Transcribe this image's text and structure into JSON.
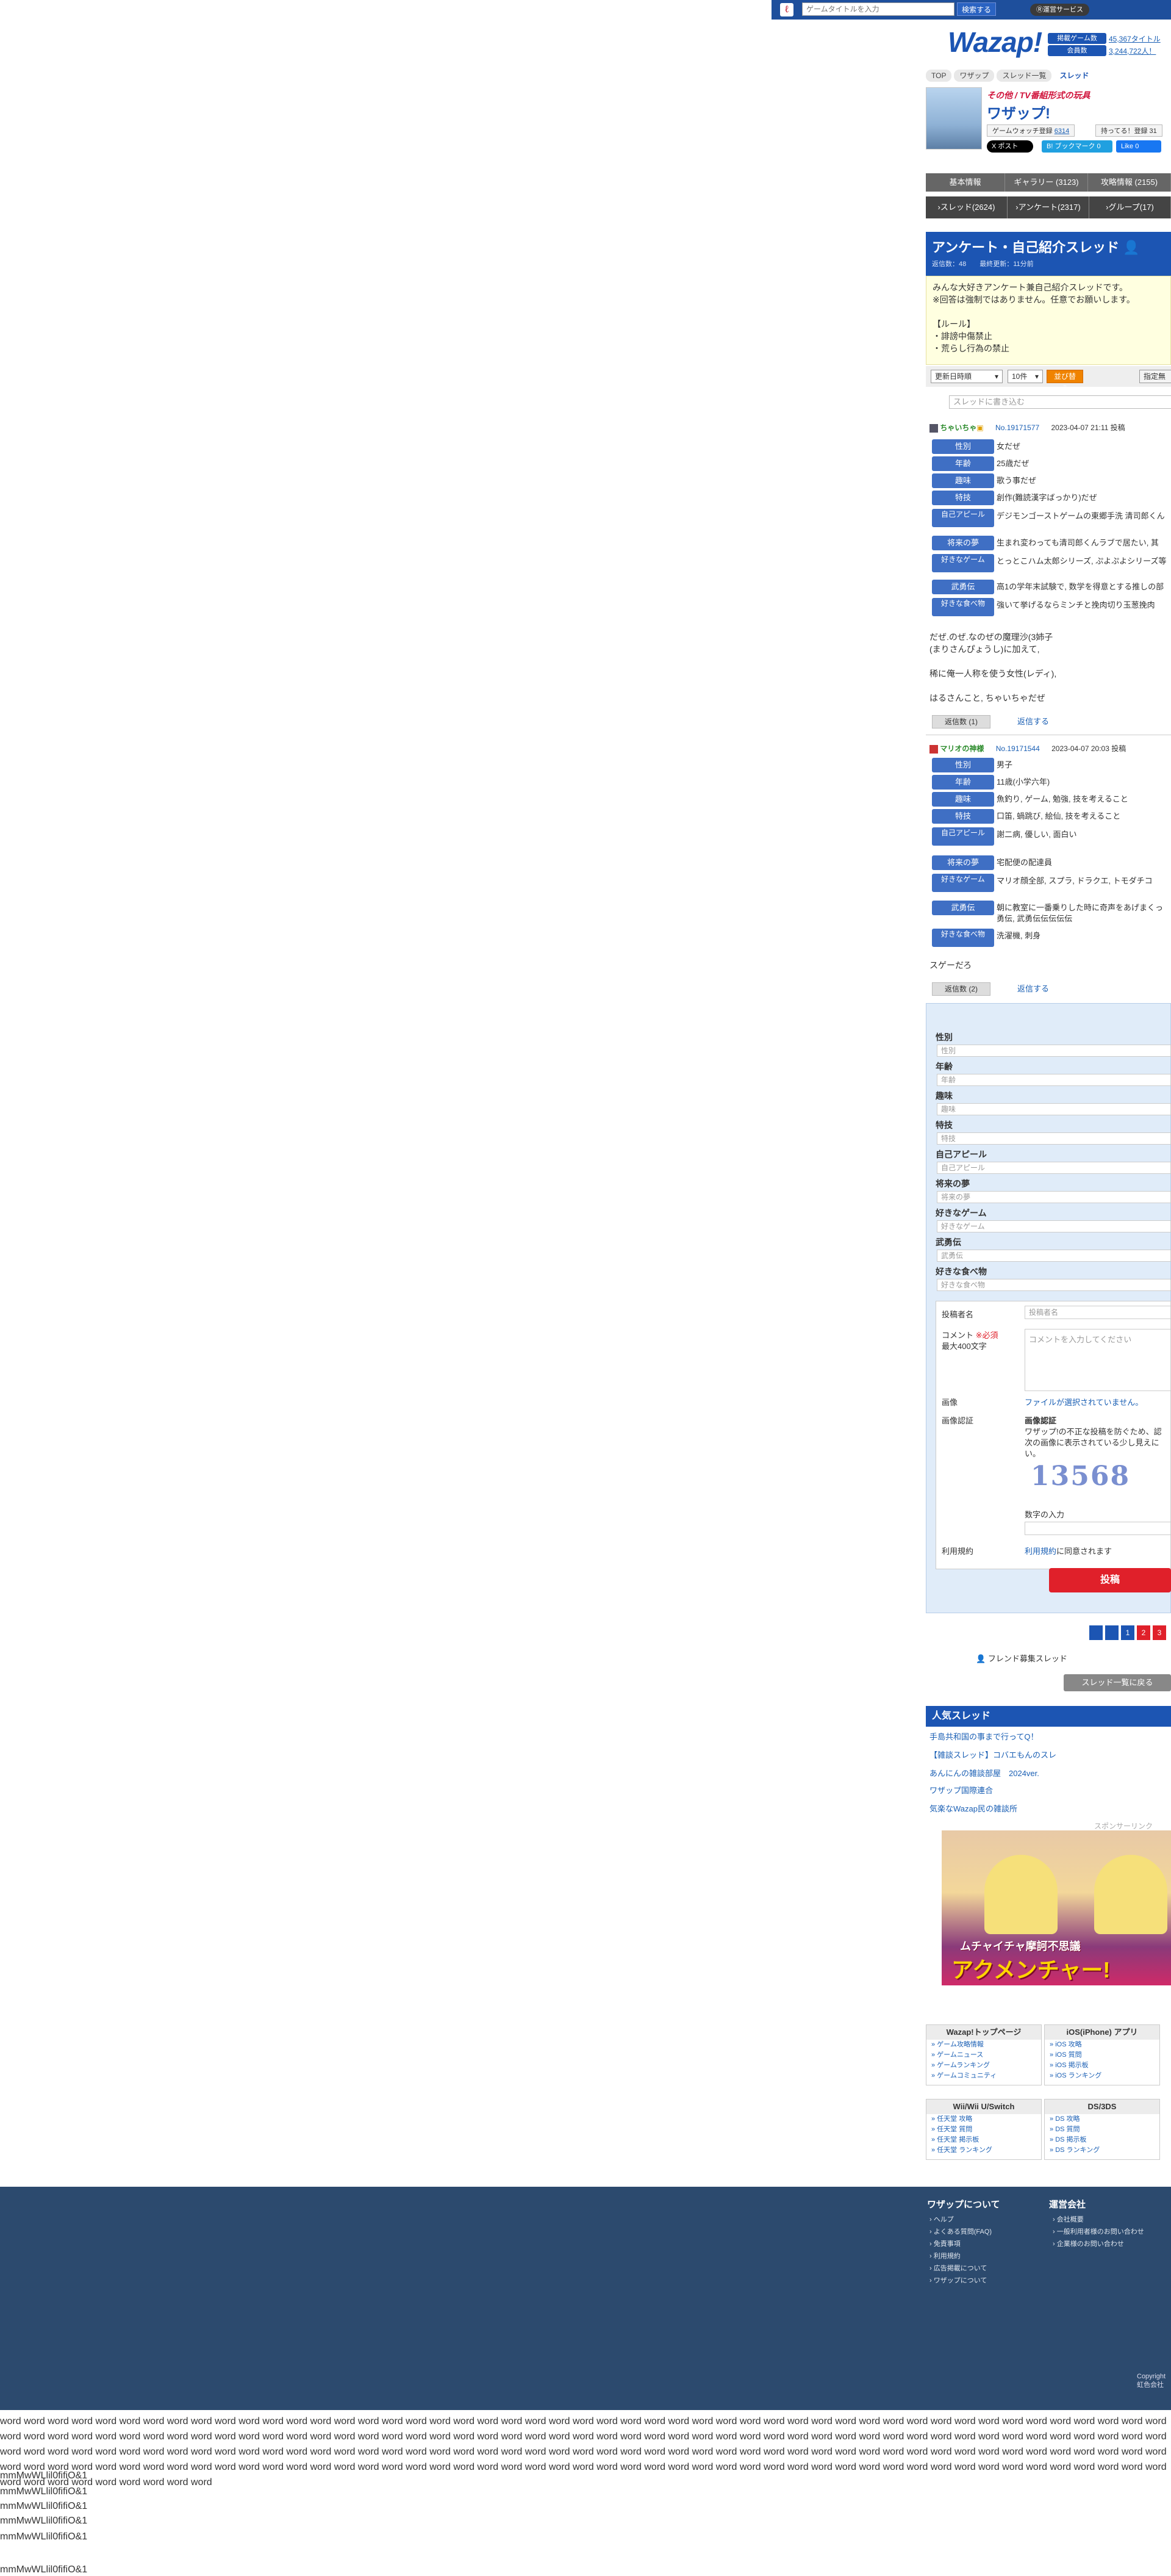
{
  "topbar": {
    "search_placeholder": "ゲームタイトルを入力",
    "search_button": "検索する",
    "service_label": "Ⓡ運営サービス"
  },
  "header": {
    "logo": "Wazap!",
    "stat_games_label": "掲載ゲーム数",
    "stat_games_value": "45,367タイトル",
    "stat_members_label": "会員数",
    "stat_members_value": "3,244,722人！"
  },
  "breadcrumb": [
    "TOP",
    "ワザップ",
    "スレッド一覧",
    "スレッド"
  ],
  "game": {
    "subtitle": "その他 / TV番組形式の玩具",
    "title": "ワザップ!",
    "watch_label": "ゲームウォッチ登録",
    "watch_count": "6314",
    "owned_label": "持ってる！登録",
    "owned_count": "31",
    "share_x": "X ポスト",
    "bookmark": "B! ブックマーク",
    "bookmark_count": "0",
    "like": "Like 0"
  },
  "tabs_row1": [
    "基本情報",
    "ギャラリー (3123)",
    "攻略情報 (2155)"
  ],
  "tabs_row2": [
    "スレッド(2624)",
    "アンケート(2317)",
    "グループ(17)"
  ],
  "thread": {
    "title": "アンケート・自己紹介スレッド",
    "meta": "返信数：48　　最終更新：11分前",
    "rules": "みんな大好きアンケート兼自己紹介スレッドです。\n※回答は強制ではありません。任意でお願いします。\n\n【ルール】\n・誹謗中傷禁止\n・荒らし行為の禁止"
  },
  "sortbar": {
    "order": "更新日時順",
    "count": "10件",
    "apply": "並び替え",
    "assign": "指定無"
  },
  "post_search_placeholder": "スレッドに書き込む",
  "posts": [
    {
      "user": "ちゃいちゃ",
      "no": "No.19171577",
      "date": "2023-04-07 21:11 投稿",
      "rows": [
        [
          "性別",
          "女だぜ"
        ],
        [
          "年齢",
          "25歳だぜ"
        ],
        [
          "趣味",
          "歌う事だぜ"
        ],
        [
          "特技",
          "創作(難読漢字ばっかり)だぜ"
        ],
        [
          "自己アピール",
          "デジモンゴーストゲームの東郷手洗 清司郎くん"
        ],
        [
          "将来の夢",
          "生まれ変わっても清司郎くんラブで居たい, 其"
        ],
        [
          "好きなゲーム",
          "とっとこハム太郎シリーズ, ぷよぷよシリーズ等"
        ],
        [
          "武勇伝",
          "高1の学年末試験で, 数学を得意とする推しの部"
        ],
        [
          "好きな食べ物",
          "強いて挙げるならミンチと挽肉切り玉葱挽肉"
        ]
      ],
      "body": "だぜ.のぜ.なのぜの魔理沙(3姉子\n(まりさんぴょうし)に加えて,\n\n稀に俺一人称を使う女性(レディ),\n\nはるさんこと, ちゃいちゃだぜ",
      "reply_count": "返信数 (1)",
      "reply_link": "返信する"
    },
    {
      "user": "マリオの神様",
      "no": "No.19171544",
      "date": "2023-04-07 20:03 投稿",
      "rows": [
        [
          "性別",
          "男子"
        ],
        [
          "年齢",
          "11歳(小学六年)"
        ],
        [
          "趣味",
          "魚釣り, ゲーム, 勉強, 技を考えること"
        ],
        [
          "特技",
          "口笛, 蝸跳び, 絵仙, 技を考えること"
        ],
        [
          "自己アピール",
          "謝二病, 優しい, 面白い"
        ],
        [
          "将来の夢",
          "宅配便の配達員"
        ],
        [
          "好きなゲーム",
          "マリオ顔全部, スプラ, ドラクエ, トモダチコ"
        ],
        [
          "武勇伝",
          "朝に教室に一番乗りした時に奇声をあげまくっ"
        ],
        [
          "",
          "勇伝, 武勇伝伝伝伝伝"
        ],
        [
          "好きな食べ物",
          "洗濯機, 刺身"
        ]
      ],
      "body": "スゲーだろ",
      "reply_count": "返信数 (2)",
      "reply_link": "返信する"
    }
  ],
  "form": {
    "fields": [
      [
        "性別",
        "性別"
      ],
      [
        "年齢",
        "年齢"
      ],
      [
        "趣味",
        "趣味"
      ],
      [
        "特技",
        "特技"
      ],
      [
        "自己アピール",
        "自己アピール"
      ],
      [
        "将来の夢",
        "将来の夢"
      ],
      [
        "好きなゲーム",
        "好きなゲーム"
      ],
      [
        "武勇伝",
        "武勇伝"
      ],
      [
        "好きな食べ物",
        "好きな食べ物"
      ]
    ],
    "author_label": "投稿者名",
    "author_placeholder": "投稿者名",
    "comment_label": "コメント",
    "required": "※必須",
    "comment_max": "最大400文字",
    "comment_placeholder": "コメントを入力してください",
    "image_label": "画像",
    "image_value": "ファイルが選択されていません。",
    "captcha_label": "画像認証",
    "captcha_title": "画像認証",
    "captcha_desc": "ワザップ!の不正な投稿を防ぐため、認\n次の画像に表示されている少し見えに\nい。",
    "captcha_digits": "13568",
    "captcha_input_label": "数字の入力",
    "terms_label": "利用規約",
    "terms_link": "利用規約",
    "terms_rest": "に同意されます",
    "submit": "投稿"
  },
  "pagination": [
    "",
    "",
    "1",
    "2",
    "3"
  ],
  "friend_link": "フレンド募集スレッド",
  "back_to_list": "スレッド一覧に戻る",
  "popular": {
    "title": "人気スレッド",
    "items": [
      "手島共和国の事まで行ってQ！",
      "【雑談スレッド】コバエもんのスレ",
      "あんにんの雑談部屋　2024ver.",
      "ワザップ国際連合",
      "気楽なWazap民の雑談所"
    ]
  },
  "ad": {
    "label": "スポンサーリンク",
    "title": "アクメンチャー!",
    "sub": "ムチャイチャ摩訶不思議"
  },
  "link_boxes": [
    {
      "title": "Wazap!トップページ",
      "links": [
        "ゲーム攻略情報",
        "ゲームニュース",
        "ゲームランキング",
        "ゲームコミュニティ"
      ]
    },
    {
      "title": "iOS(iPhone) アプリ",
      "links": [
        "iOS 攻略",
        "iOS 質問",
        "iOS 掲示板",
        "iOS ランキング"
      ]
    },
    {
      "title": "Wii/Wii U/Switch",
      "links": [
        "任天堂 攻略",
        "任天堂 質問",
        "任天堂 掲示板",
        "任天堂 ランキング"
      ]
    },
    {
      "title": "DS/3DS",
      "links": [
        "DS 攻略",
        "DS 質問",
        "DS 掲示板",
        "DS ランキング"
      ]
    }
  ],
  "footer": {
    "about_title": "ワザップについて",
    "about_links": [
      "ヘルプ",
      "よくある質問(FAQ)",
      "免責事項",
      "利用規約",
      "広告掲載について",
      "ワザップについて"
    ],
    "company_title": "運営会社",
    "company_links": [
      "会社概要",
      "一般利用者様のお問い合わせ",
      "企業様のお問い合わせ"
    ],
    "copyright_1": "Copyright",
    "copyright_2": "虹色会社"
  },
  "tail": {
    "words": "word word word word word word word word word word word word word word word word word word word word word word word word word word word word word word word word word word word word word word word word word word word word word word word word word word word word word word word word word word word word word word word word word word word word word word word word word word word word word word word word word word word word word word word word word word word word word word word word word word word word word word word word word word word word word word word word word word word word word word word word word word word word word word word word word word word word word word word word word word word word word word word word word word word word word word word word word word word word word word word word word word word word word word word word word word word word word word word word word word word word word word word word word word word word word word word word word word word word word word word word word word word word word",
    "glyphs": "mmMwWLlil0fifiO&1"
  },
  "colors": {
    "brand": "#1c55b3",
    "accent_red": "#e0202a",
    "footer": "#2c4a6e"
  }
}
